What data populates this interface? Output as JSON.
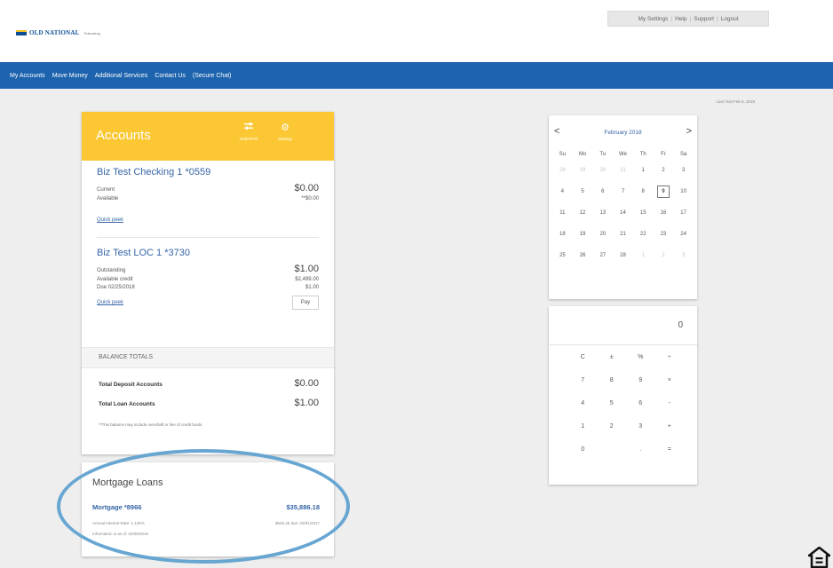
{
  "header": {
    "brand": "OLD NATIONAL",
    "brand_sub": "Telecaring",
    "util_links": [
      "My Settings",
      "Help",
      "Support",
      "Logout"
    ]
  },
  "nav": {
    "items": [
      "My Accounts",
      "Move Money",
      "Additional Services",
      "Contact Us",
      "(Secure Chat)"
    ]
  },
  "last_visit": "Last Visit Feb 8, 2018",
  "accounts": {
    "title": "Accounts",
    "header_buttons": [
      {
        "icon": "equalizer-icon",
        "label": "Order/Pref"
      },
      {
        "icon": "gear-icon",
        "label": "Settings"
      }
    ],
    "items": [
      {
        "name": "Biz Test Checking 1 *0559",
        "rows": [
          {
            "label": "Current",
            "value": "$0.00"
          },
          {
            "label": "Available",
            "value": "**$0.00"
          }
        ],
        "quick_peek": "Quick peek"
      },
      {
        "name": "Biz Test LOC 1 *3730",
        "rows": [
          {
            "label": "Outstanding",
            "value": "$1.00"
          },
          {
            "label": "Available credit",
            "value": "$2,499.00"
          },
          {
            "label": "Due 02/25/2018",
            "value": "$1.00"
          }
        ],
        "quick_peek": "Quick peek",
        "pay_label": "Pay"
      }
    ],
    "balance_totals_label": "BALANCE TOTALS",
    "totals": [
      {
        "label": "Total Deposit Accounts",
        "value": "$0.00"
      },
      {
        "label": "Total Loan Accounts",
        "value": "$1.00"
      }
    ],
    "footnote": "**This balance may include overdraft or line of credit funds."
  },
  "mortgage": {
    "title": "Mortgage Loans",
    "name": "Mortgage *8966",
    "amount": "$35,886.18",
    "rate": "Annual Interest Rate: 1.125%",
    "due": "$626.45 due: 03/01/2017",
    "as_of": "Information is as of: 02/08/2018"
  },
  "calendar": {
    "prev": "<",
    "next": ">",
    "month": "February 2018",
    "dow": [
      "Su",
      "Mo",
      "Tu",
      "We",
      "Th",
      "Fr",
      "Sa"
    ],
    "weeks": [
      [
        {
          "d": "28",
          "m": true
        },
        {
          "d": "29",
          "m": true
        },
        {
          "d": "30",
          "m": true
        },
        {
          "d": "31",
          "m": true
        },
        {
          "d": "1"
        },
        {
          "d": "2"
        },
        {
          "d": "3"
        }
      ],
      [
        {
          "d": "4"
        },
        {
          "d": "5"
        },
        {
          "d": "6"
        },
        {
          "d": "7"
        },
        {
          "d": "8"
        },
        {
          "d": "9",
          "t": true
        },
        {
          "d": "10"
        }
      ],
      [
        {
          "d": "11"
        },
        {
          "d": "12"
        },
        {
          "d": "13"
        },
        {
          "d": "14"
        },
        {
          "d": "15"
        },
        {
          "d": "16"
        },
        {
          "d": "17"
        }
      ],
      [
        {
          "d": "18"
        },
        {
          "d": "19"
        },
        {
          "d": "20"
        },
        {
          "d": "21"
        },
        {
          "d": "22"
        },
        {
          "d": "23"
        },
        {
          "d": "24"
        }
      ],
      [
        {
          "d": "25"
        },
        {
          "d": "26"
        },
        {
          "d": "27"
        },
        {
          "d": "28"
        },
        {
          "d": "1",
          "m": true
        },
        {
          "d": "2",
          "m": true
        },
        {
          "d": "3",
          "m": true
        }
      ]
    ]
  },
  "calculator": {
    "display": "0",
    "keys": [
      "C",
      "±",
      "%",
      "÷",
      "7",
      "8",
      "9",
      "×",
      "4",
      "5",
      "6",
      "-",
      "1",
      "2",
      "3",
      "+",
      "0",
      "",
      ".",
      "="
    ]
  }
}
